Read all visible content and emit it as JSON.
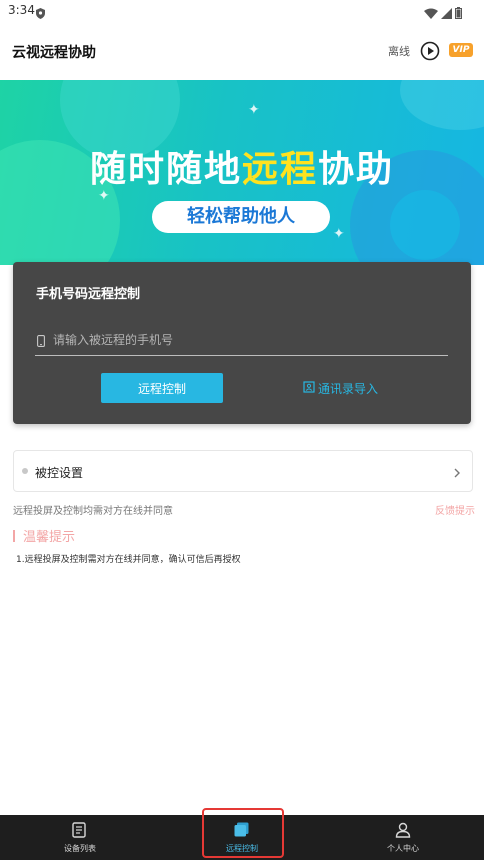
{
  "status_bar": {
    "time": "3:34"
  },
  "header": {
    "title": "云视远程协助",
    "status": "离线",
    "vip_badge": "VIP"
  },
  "banner": {
    "headline_part1": "随时随地",
    "headline_highlight": "远程",
    "headline_part2": "协助",
    "subtitle": "轻松帮助他人"
  },
  "card": {
    "title": "手机号码远程控制",
    "phone_placeholder": "请输入被远程的手机号",
    "phone_value": "",
    "remote_button": "远程控制",
    "contacts_link": "通讯录导入"
  },
  "settings": {
    "label": "被控设置"
  },
  "note": "远程投屏及控制均需对方在线并同意",
  "feedback_link": "反馈提示",
  "tips": {
    "title": "温馨提示",
    "text": "1.远程投屏及控制需对方在线并同意，确认可信后再授权"
  },
  "tabs": [
    {
      "label": "设备列表",
      "icon": "device-list-icon",
      "active": false
    },
    {
      "label": "远程控制",
      "icon": "remote-control-icon",
      "active": true
    },
    {
      "label": "个人中心",
      "icon": "profile-icon",
      "active": false
    }
  ],
  "colors": {
    "accent": "#28b7e2",
    "banner_start": "#1ed3a5",
    "banner_end": "#16b6e3",
    "headline_highlight": "#ffe21f",
    "vip": "#f7a12b",
    "card_bg": "#474747",
    "tip_color": "#f3a6a6",
    "tabbar_bg": "#1e1e1e"
  }
}
